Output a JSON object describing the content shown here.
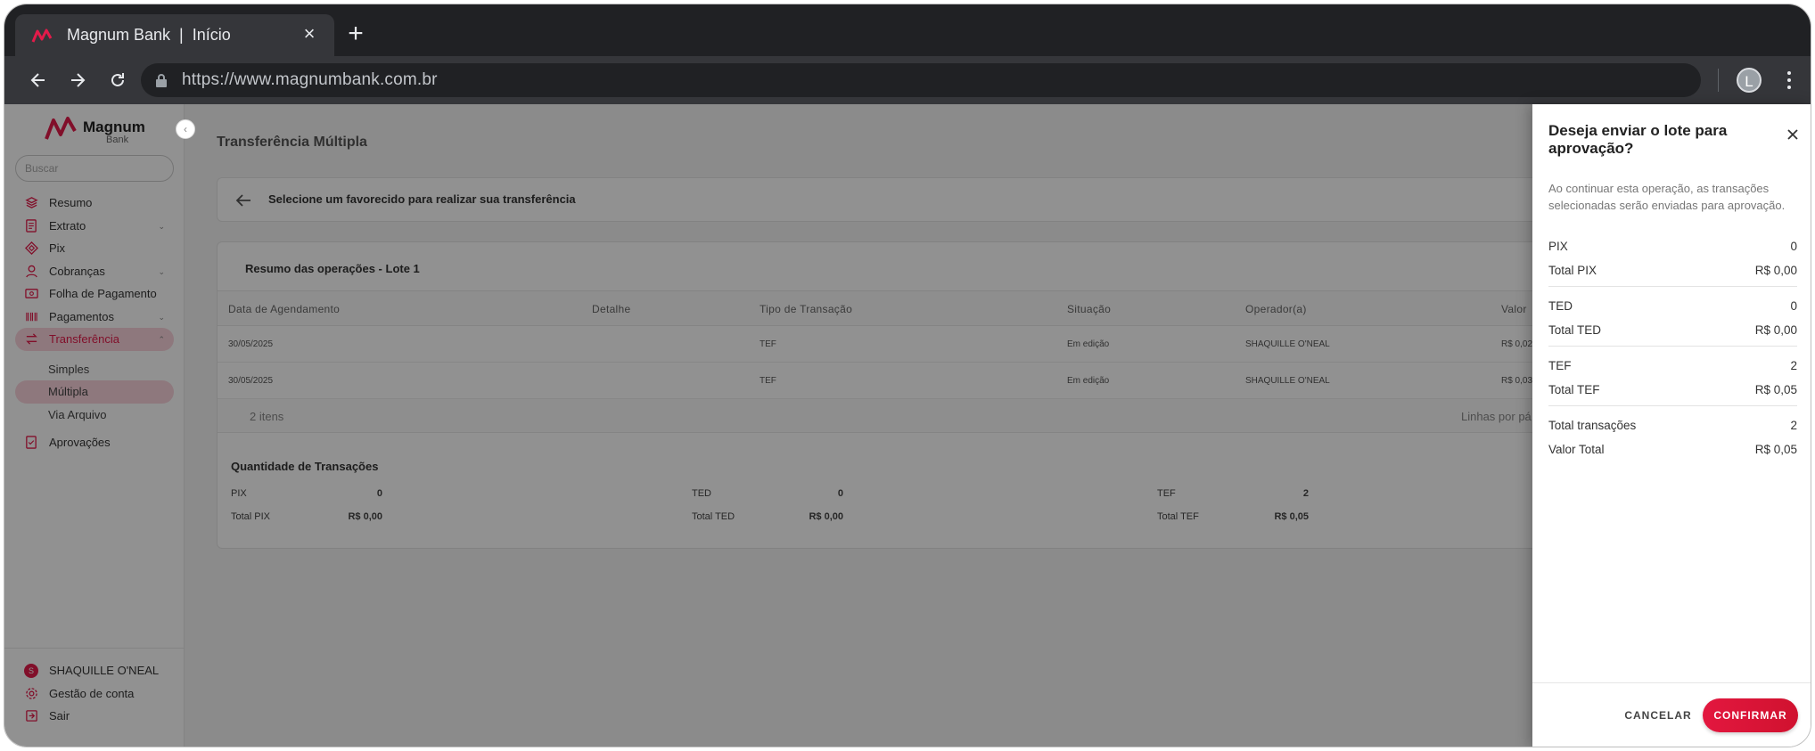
{
  "browser": {
    "tab_title": "Magnum Bank  |  Início",
    "url": "https://www.magnumbank.com.br",
    "profile_initial": "L"
  },
  "brand": {
    "name": "Magnum",
    "sub": "Bank",
    "color": "#e31b4a"
  },
  "sidebar": {
    "search_placeholder": "Buscar",
    "items": [
      {
        "label": "Resumo",
        "icon": "layers-icon"
      },
      {
        "label": "Extrato",
        "icon": "document-icon",
        "chevron": true
      },
      {
        "label": "Pix",
        "icon": "pix-icon"
      },
      {
        "label": "Cobranças",
        "icon": "billing-icon",
        "chevron": true
      },
      {
        "label": "Folha de Pagamento",
        "icon": "payroll-icon"
      },
      {
        "label": "Pagamentos",
        "icon": "barcode-icon",
        "chevron": true
      },
      {
        "label": "Transferência",
        "icon": "transfer-icon",
        "chevron": true,
        "active": true
      }
    ],
    "sub_items": [
      "Simples",
      "Múltipla",
      "Via Arquivo"
    ],
    "approvals": "Aprovações",
    "footer": {
      "user": "SHAQUILLE O'NEAL",
      "user_initial": "S",
      "account": "Gestão de conta",
      "logout": "Sair"
    }
  },
  "main": {
    "title": "Transferência Múltipla",
    "select_text": "Selecione um favorecido para realizar sua transferência",
    "resumo_title": "Resumo das operações - Lote 1",
    "columns": [
      "Data de Agendamento",
      "Detalhe",
      "Tipo de Transação",
      "Situação",
      "Operador(a)",
      "Valor"
    ],
    "rows": [
      [
        "30/05/2025",
        "",
        "TEF",
        "Em edição",
        "SHAQUILLE O'NEAL",
        "R$ 0,02"
      ],
      [
        "30/05/2025",
        "",
        "TEF",
        "Em edição",
        "SHAQUILLE O'NEAL",
        "R$ 0,03"
      ]
    ],
    "items_count": "2 itens",
    "lines_per_page": "Linhas por pá",
    "quantity_title": "Quantidade de Transações",
    "quantity": {
      "pix": {
        "label": "PIX",
        "count": "0",
        "total_label": "Total PIX",
        "total": "R$ 0,00"
      },
      "ted": {
        "label": "TED",
        "count": "0",
        "total_label": "Total TED",
        "total": "R$ 0,00"
      },
      "tef": {
        "label": "TEF",
        "count": "2",
        "total_label": "Total TEF",
        "total": "R$ 0,05"
      }
    }
  },
  "drawer": {
    "title": "Deseja enviar o lote para aprovação?",
    "description": "Ao continuar esta operação, as transações selecionadas serão enviadas para aprovação.",
    "pix_label": "PIX",
    "pix_count": "0",
    "total_pix_label": "Total PIX",
    "total_pix": "R$ 0,00",
    "ted_label": "TED",
    "ted_count": "0",
    "total_ted_label": "Total TED",
    "total_ted": "R$ 0,00",
    "tef_label": "TEF",
    "tef_count": "2",
    "total_tef_label": "Total TEF",
    "total_tef": "R$ 0,05",
    "total_tx_label": "Total transações",
    "total_tx": "2",
    "total_value_label": "Valor Total",
    "total_value": "R$ 0,05",
    "cancel": "CANCELAR",
    "confirm": "CONFIRMAR"
  }
}
